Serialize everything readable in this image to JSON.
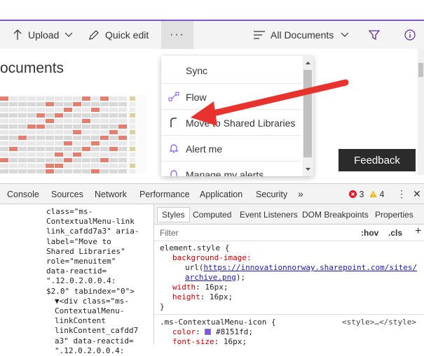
{
  "toolbar": {
    "upload": "Upload",
    "quick_edit": "Quick edit",
    "more": "···",
    "all_documents": "All Documents"
  },
  "library_title": "ocuments",
  "menu": {
    "items": [
      {
        "label": "Sync",
        "icon": "sync-icon"
      },
      {
        "label": "Flow",
        "icon": "flow-icon"
      },
      {
        "label": "Move to Shared Libraries",
        "icon": "move-icon"
      },
      {
        "label": "Alert me",
        "icon": "bell-icon"
      },
      {
        "label": "Manage my alerts",
        "icon": "alerts-icon"
      }
    ]
  },
  "feedback": "Feedback",
  "devtools": {
    "tabs": [
      "Console",
      "Sources",
      "Network",
      "Performance",
      "Application",
      "Security",
      "»"
    ],
    "errors": "3",
    "warnings": "4",
    "menu": "⋮",
    "close": "✕",
    "styles_tabs": [
      "Styles",
      "Computed",
      "Event Listeners",
      "DOM Breakpoints",
      "Properties"
    ],
    "filter_placeholder": "Filter",
    "hov": ":hov",
    "cls": ".cls",
    "plus": "+"
  },
  "dom_lines": [
    "class=\"ms-",
    "ContextualMenu-link",
    "link_cafdd7a3\" aria-",
    "label=\"Move to",
    "Shared Libraries\"",
    "role=\"menuitem\"",
    "data-reactid=",
    "\".12.0.2.0.0.4:",
    "$2.0\" tabindex=\"0\">",
    "▼<div class=\"ms-",
    "ContextualMenu-",
    "linkContent",
    "linkContent_cafdd7",
    "a3\" data-reactid=",
    "\".12.0.2.0.0.4:"
  ],
  "styles": {
    "element_style": "element.style {",
    "bg_prop": "background-image:",
    "bg_url_pre": "url(",
    "bg_url_link": "https://innovationnorway.sharepoint.com/sites/",
    "bg_url_link2": "archive.png",
    "bg_url_post": ");",
    "width_prop": "width",
    "width_val": "16px;",
    "height_prop": "height",
    "height_val": "16px;",
    "close_brace": "}",
    "rule2_selector": ".ms-ContextualMenu-icon {",
    "rule2_source": "<style>…</style>",
    "color_prop": "color",
    "color_val": "#8151fd;",
    "font_prop": "font-size",
    "font_val": "16px;"
  },
  "colors": {
    "accent": "#7b57c8",
    "menu_icon": "#8151fd",
    "error": "#e81123",
    "warning": "#c27d00"
  }
}
